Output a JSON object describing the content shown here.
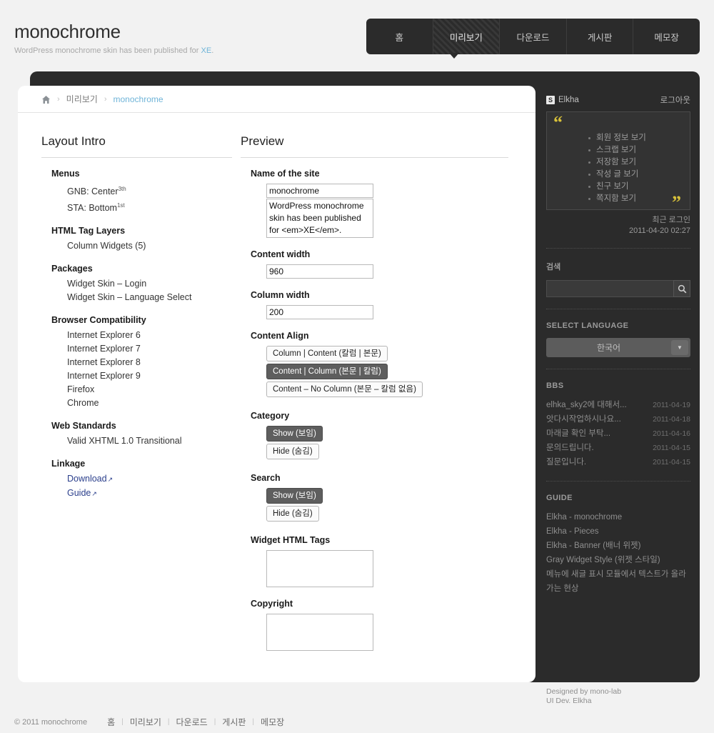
{
  "header": {
    "title": "monochrome",
    "subtitle_before": "WordPress monochrome skin has been published for ",
    "subtitle_link": "XE",
    "subtitle_after": ".",
    "nav": [
      {
        "label": "홈",
        "active": false
      },
      {
        "label": "미리보기",
        "active": true
      },
      {
        "label": "다운로드",
        "active": false
      },
      {
        "label": "게시판",
        "active": false
      },
      {
        "label": "메모장",
        "active": false
      }
    ]
  },
  "breadcrumb": {
    "home_icon": "home-icon",
    "separator": "›",
    "items": [
      "미리보기",
      "monochrome"
    ]
  },
  "left_column": {
    "title": "Layout Intro",
    "groups": [
      {
        "head": "Menus",
        "items": [
          {
            "text": "GNB: Center",
            "sup": "3th"
          },
          {
            "text": "STA: Bottom",
            "sup": "1st"
          }
        ]
      },
      {
        "head": "HTML Tag Layers",
        "items": [
          {
            "text": "Column Widgets (5)",
            "sup": ""
          }
        ]
      },
      {
        "head": "Packages",
        "items": [
          {
            "text": "Widget Skin – Login",
            "sup": ""
          },
          {
            "text": "Widget Skin – Language Select",
            "sup": ""
          }
        ]
      },
      {
        "head": "Browser Compatibility",
        "items": [
          {
            "text": "Internet Explorer 6",
            "sup": ""
          },
          {
            "text": "Internet Explorer 7",
            "sup": ""
          },
          {
            "text": "Internet Explorer 8",
            "sup": ""
          },
          {
            "text": "Internet Explorer 9",
            "sup": ""
          },
          {
            "text": "Firefox",
            "sup": ""
          },
          {
            "text": "Chrome",
            "sup": ""
          }
        ]
      },
      {
        "head": "Web Standards",
        "items": [
          {
            "text": "Valid XHTML 1.0 Transitional",
            "sup": ""
          }
        ]
      },
      {
        "head": "Linkage",
        "links": [
          {
            "text": "Download",
            "icon": "external-link-icon"
          },
          {
            "text": "Guide",
            "icon": "external-link-icon"
          }
        ]
      }
    ]
  },
  "preview": {
    "title": "Preview",
    "name_label": "Name of the site",
    "name_value": "monochrome",
    "desc_value": "WordPress monochrome skin has been published for <em>XE</em>.",
    "content_width_label": "Content width",
    "content_width_value": "960",
    "column_width_label": "Column width",
    "column_width_value": "200",
    "content_align_label": "Content Align",
    "content_align_options": [
      {
        "label": "Column | Content (칼럼 | 본문)",
        "selected": false
      },
      {
        "label": "Content | Column (본문 | 칼럼)",
        "selected": true
      },
      {
        "label": "Content – No Column (본문 – 칼럼 없음)",
        "selected": false
      }
    ],
    "category_label": "Category",
    "category_options": [
      {
        "label": "Show (보임)",
        "selected": true
      },
      {
        "label": "Hide (숨김)",
        "selected": false
      }
    ],
    "search_label": "Search",
    "search_options": [
      {
        "label": "Show (보임)",
        "selected": true
      },
      {
        "label": "Hide (숨김)",
        "selected": false
      }
    ],
    "widget_tags_label": "Widget HTML Tags",
    "widget_tags_value": "",
    "copyright_label": "Copyright",
    "copyright_value": ""
  },
  "sidebar": {
    "user_badge": "S",
    "username": "Elkha",
    "logout_label": "로그아웃",
    "login_menu": [
      "회원 정보 보기",
      "스크랩 보기",
      "저장함 보기",
      "작성 글 보기",
      "친구 보기",
      "쪽지함 보기"
    ],
    "last_login_label": "최근 로그인",
    "last_login_time": "2011-04-20 02:27",
    "search_title": "검색",
    "search_placeholder": "",
    "search_value": "",
    "search_icon": "magnifier-icon",
    "language_title": "SELECT LANGUAGE",
    "language_value": "한국어",
    "language_arrow_icon": "chevron-down-icon",
    "bbs_title": "BBS",
    "bbs_items": [
      {
        "title": "elhka_sky2에 대해서...",
        "date": "2011-04-19"
      },
      {
        "title": "앗다시작업하시나요...",
        "date": "2011-04-18"
      },
      {
        "title": "마래글 확인 부탁...",
        "date": "2011-04-16"
      },
      {
        "title": "문의드립니다.",
        "date": "2011-04-15"
      },
      {
        "title": "질문입니다.",
        "date": "2011-04-15"
      }
    ],
    "guide_title": "GUIDE",
    "guide_items": [
      "Elkha - monochrome",
      "Elkha - Pieces",
      "Elkha - Banner (배너 위젯)",
      "Gray Widget Style (위젯 스타일)",
      "메뉴에 새글 표시 모듈에서 텍스트가 올라가는 현상"
    ],
    "credit_line1": "Designed by mono-lab",
    "credit_line2": "UI Dev. Elkha"
  },
  "footer": {
    "copyright": "© 2011 monochrome",
    "nav": [
      "홈",
      "미리보기",
      "다운로드",
      "게시판",
      "메모장"
    ],
    "separator": "|"
  },
  "colors": {
    "page_bg": "#f2f2f2",
    "dark": "#2b2b2b",
    "accent_link": "#6fb4d8",
    "quote_yellow": "#d8c13a",
    "selected_btn": "#5e5e5e"
  }
}
